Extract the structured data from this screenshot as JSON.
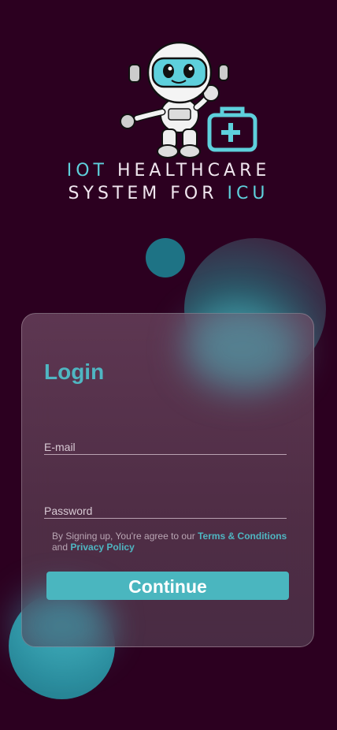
{
  "brand": {
    "line1_accent": "IOT",
    "line1_rest": " HEALTHCARE",
    "line2_rest": "SYSTEM FOR ",
    "line2_accent": "ICU",
    "accent_color": "#5ed0dc"
  },
  "login": {
    "title": "Login",
    "email_label": "E-mail",
    "password_label": "Password",
    "terms_prefix": "By Signing up, You're agree to our ",
    "terms_link": "Terms & Conditions",
    "terms_middle": " and ",
    "privacy_link": "Privacy Policy",
    "continue_label": "Continue"
  },
  "icons": {
    "mascot": "astronaut-robot-icon",
    "medical_kit": "medical-kit-icon"
  },
  "colors": {
    "background": "#2c0020",
    "primary": "#4ab6bf",
    "title": "#4fb6c2"
  }
}
